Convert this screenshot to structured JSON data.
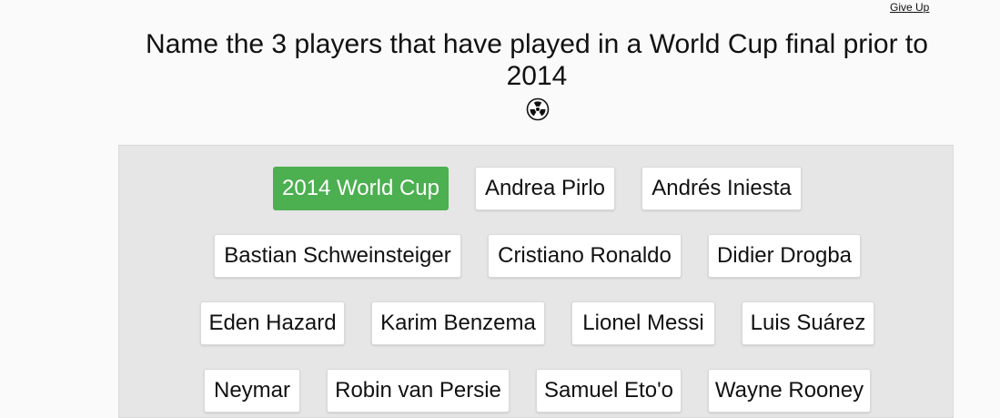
{
  "header": {
    "give_up_label": "Give Up"
  },
  "question": {
    "text": "Name the 3 players that have played in a World Cup final prior to 2014",
    "icon": "radioactive-icon"
  },
  "colors": {
    "selected": "#4caf50",
    "board_background": "#e6e6e6",
    "button_background": "#ffffff"
  },
  "options": [
    {
      "label": "2014 World Cup",
      "selected": true
    },
    {
      "label": "Andrea Pirlo",
      "selected": false
    },
    {
      "label": "Andrés Iniesta",
      "selected": false
    },
    {
      "label": "Bastian Schweinsteiger",
      "selected": false
    },
    {
      "label": "Cristiano Ronaldo",
      "selected": false
    },
    {
      "label": "Didier Drogba",
      "selected": false
    },
    {
      "label": "Eden Hazard",
      "selected": false
    },
    {
      "label": "Karim Benzema",
      "selected": false
    },
    {
      "label": "Lionel Messi",
      "selected": false
    },
    {
      "label": "Luis Suárez",
      "selected": false
    },
    {
      "label": "Neymar",
      "selected": false
    },
    {
      "label": "Robin van Persie",
      "selected": false
    },
    {
      "label": "Samuel Eto'o",
      "selected": false
    },
    {
      "label": "Wayne Rooney",
      "selected": false
    }
  ]
}
